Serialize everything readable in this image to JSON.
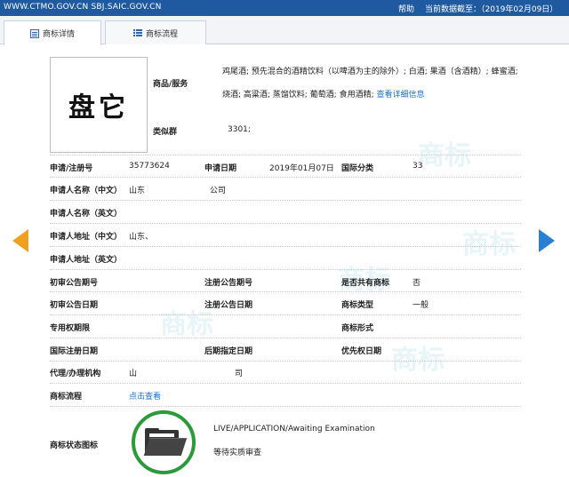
{
  "topbar": {
    "site": "WWW.CTMO.GOV.CN SBJ.SAIC.GOV.CN",
    "help": "帮助",
    "data_date": "当前数据截至：（2019年02月09日）"
  },
  "tabs": [
    {
      "label": "商标详情",
      "active": true
    },
    {
      "label": "商标流程",
      "active": false
    }
  ],
  "logo": {
    "text": "盘它"
  },
  "goods": {
    "label": "商品/服务",
    "text": "鸡尾酒; 预先混合的酒精饮料（以啤酒为主的除外）; 白酒; 果酒（含酒精）; 蜂蜜酒; 烧酒; 高粱酒; 蒸馏饮料; 葡萄酒; 食用酒精;",
    "more_link": "查看详细信息"
  },
  "similar_group": {
    "label": "类似群",
    "value": "3301;"
  },
  "row_reg": {
    "reg_no_label": "申请/注册号",
    "reg_no": "35773624",
    "date_label": "申请日期",
    "date": "2019年01月07日",
    "class_label": "国际分类",
    "class": "33"
  },
  "applicant_cn": {
    "label": "申请人名称（中文）",
    "value_a": "山东",
    "value_b": "公司"
  },
  "applicant_en": {
    "label": "申请人名称（英文）"
  },
  "address_cn": {
    "label": "申请人地址（中文）",
    "value": "山东、"
  },
  "address_en": {
    "label": "申请人地址（英文）"
  },
  "row_prelim": {
    "a": "初审公告期号",
    "b": "注册公告期号",
    "c": "是否共有商标",
    "c_val": "否"
  },
  "row_prelim_date": {
    "a": "初审公告日期",
    "b": "注册公告日期",
    "c": "商标类型",
    "c_val": "一般"
  },
  "row_exclusive": {
    "a": "专用权期限",
    "c": "商标形式"
  },
  "row_intl": {
    "a": "国际注册日期",
    "b": "后期指定日期",
    "c": "优先权日期"
  },
  "agent": {
    "label": "代理/办理机构",
    "value_a": "山",
    "value_b": "司"
  },
  "process": {
    "label": "商标流程",
    "link": "点击查看"
  },
  "status": {
    "label": "商标状态图标",
    "en": "LIVE/APPLICATION/Awaiting Examination",
    "cn": "等待实质审查"
  },
  "watermark": "商标",
  "colors": {
    "topbar": "#1f5aa0",
    "link": "#1a6fc9",
    "arrow_left": "#f0a020",
    "arrow_right": "#2a7fd0",
    "status_ring": "#2a9a3a"
  },
  "icons": [
    "list-icon",
    "grid-list-icon",
    "chevron-left-icon",
    "chevron-right-icon",
    "folder-open-icon"
  ]
}
